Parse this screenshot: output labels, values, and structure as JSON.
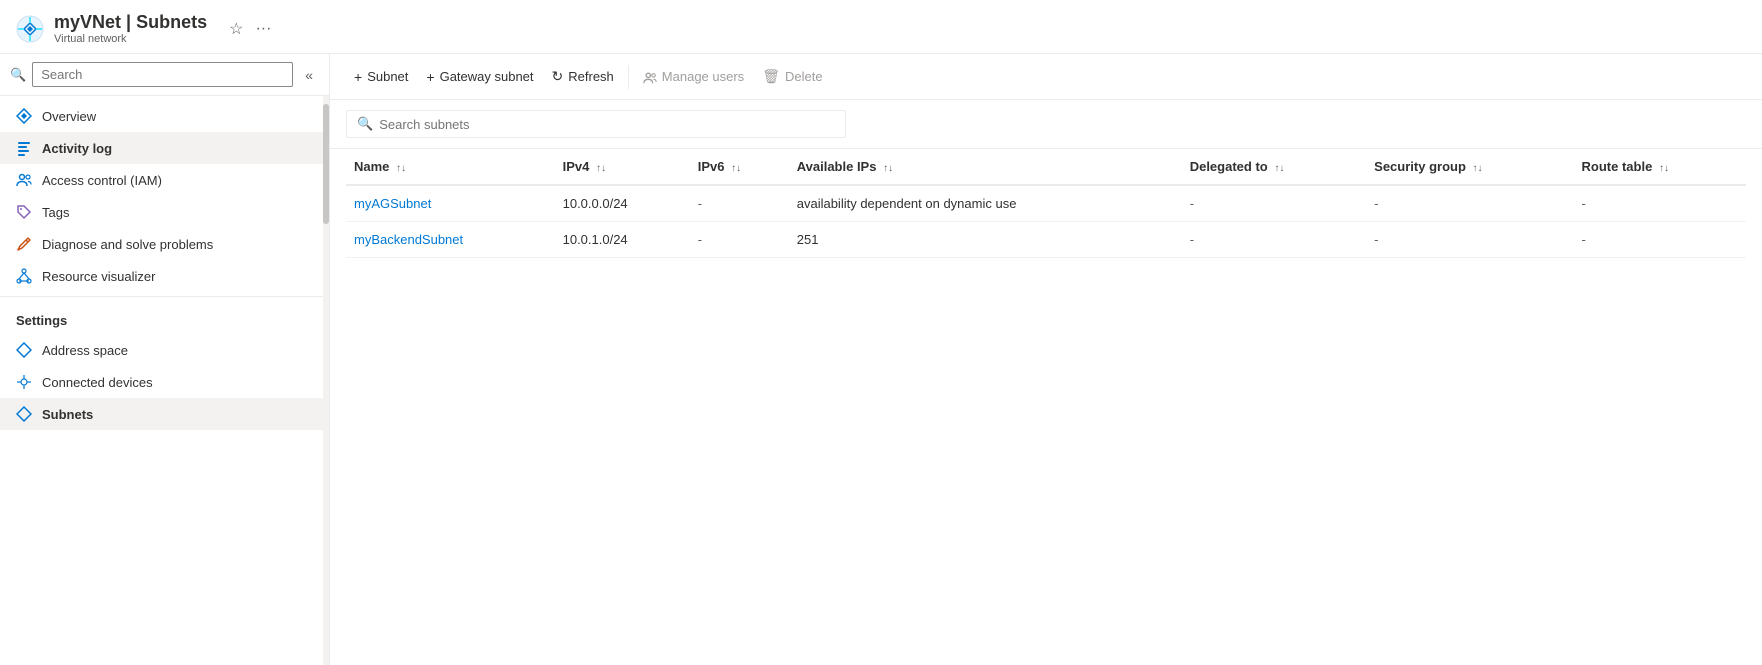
{
  "header": {
    "resource_name": "myVNet",
    "separator": "|",
    "page_title": "Subnets",
    "resource_type": "Virtual network"
  },
  "sidebar": {
    "search_placeholder": "Search",
    "nav_items": [
      {
        "id": "overview",
        "label": "Overview",
        "icon": "diamond"
      },
      {
        "id": "activity-log",
        "label": "Activity log",
        "icon": "list",
        "active": true
      },
      {
        "id": "access-control",
        "label": "Access control (IAM)",
        "icon": "person-group"
      },
      {
        "id": "tags",
        "label": "Tags",
        "icon": "tag"
      },
      {
        "id": "diagnose",
        "label": "Diagnose and solve problems",
        "icon": "wrench"
      },
      {
        "id": "resource-visualizer",
        "label": "Resource visualizer",
        "icon": "hierarchy"
      }
    ],
    "settings_section": "Settings",
    "settings_items": [
      {
        "id": "address-space",
        "label": "Address space",
        "icon": "diamond"
      },
      {
        "id": "connected-devices",
        "label": "Connected devices",
        "icon": "plug"
      },
      {
        "id": "subnets",
        "label": "Subnets",
        "icon": "diamond"
      }
    ]
  },
  "toolbar": {
    "add_subnet_label": "Subnet",
    "add_gateway_label": "Gateway subnet",
    "refresh_label": "Refresh",
    "manage_users_label": "Manage users",
    "delete_label": "Delete"
  },
  "search": {
    "placeholder": "Search subnets"
  },
  "table": {
    "columns": [
      {
        "id": "name",
        "label": "Name"
      },
      {
        "id": "ipv4",
        "label": "IPv4"
      },
      {
        "id": "ipv6",
        "label": "IPv6"
      },
      {
        "id": "available-ips",
        "label": "Available IPs"
      },
      {
        "id": "delegated-to",
        "label": "Delegated to"
      },
      {
        "id": "security-group",
        "label": "Security group"
      },
      {
        "id": "route-table",
        "label": "Route table"
      }
    ],
    "rows": [
      {
        "name": "myAGSubnet",
        "ipv4": "10.0.0.0/24",
        "ipv6": "-",
        "available_ips": "availability dependent on dynamic use",
        "delegated_to": "-",
        "security_group": "-",
        "route_table": "-"
      },
      {
        "name": "myBackendSubnet",
        "ipv4": "10.0.1.0/24",
        "ipv6": "-",
        "available_ips": "251",
        "delegated_to": "-",
        "security_group": "-",
        "route_table": "-"
      }
    ]
  }
}
